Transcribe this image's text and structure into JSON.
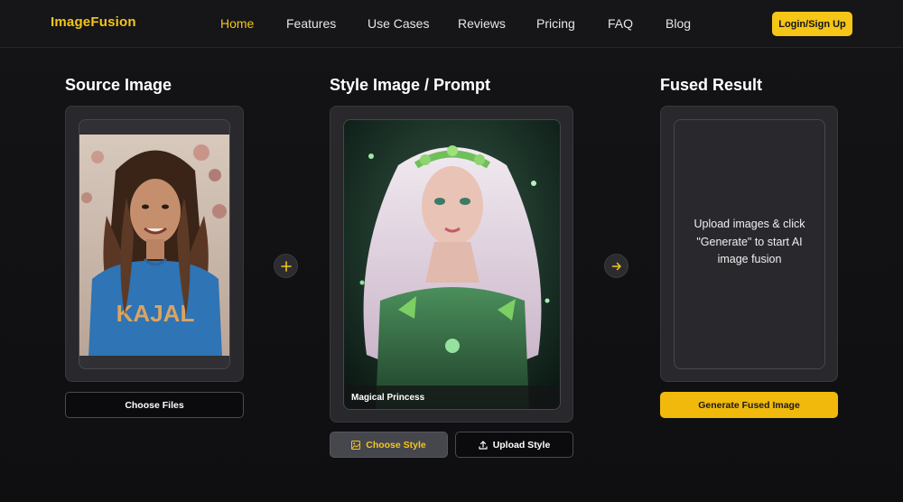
{
  "header": {
    "logo": "ImageFusion",
    "nav": [
      "Home",
      "Features",
      "Use Cases",
      "Reviews",
      "Pricing",
      "FAQ",
      "Blog"
    ],
    "active": "Home",
    "login_label": "Login/Sign Up"
  },
  "source": {
    "title": "Source Image",
    "shirt_text": "KAJAL",
    "choose_files_label": "Choose Files"
  },
  "style": {
    "title": "Style Image / Prompt",
    "caption": "Magical Princess",
    "choose_style_label": "Choose Style",
    "upload_style_label": "Upload Style"
  },
  "result": {
    "title": "Fused Result",
    "placeholder": "Upload images & click \"Generate\" to start AI image fusion",
    "generate_label": "Generate Fused Image"
  },
  "icons": {
    "plus": "plus-icon",
    "arrow": "arrow-right-icon",
    "image": "image-icon",
    "upload": "upload-icon"
  },
  "colors": {
    "accent": "#f5c518",
    "background": "#121214",
    "panel": "#29292d"
  }
}
